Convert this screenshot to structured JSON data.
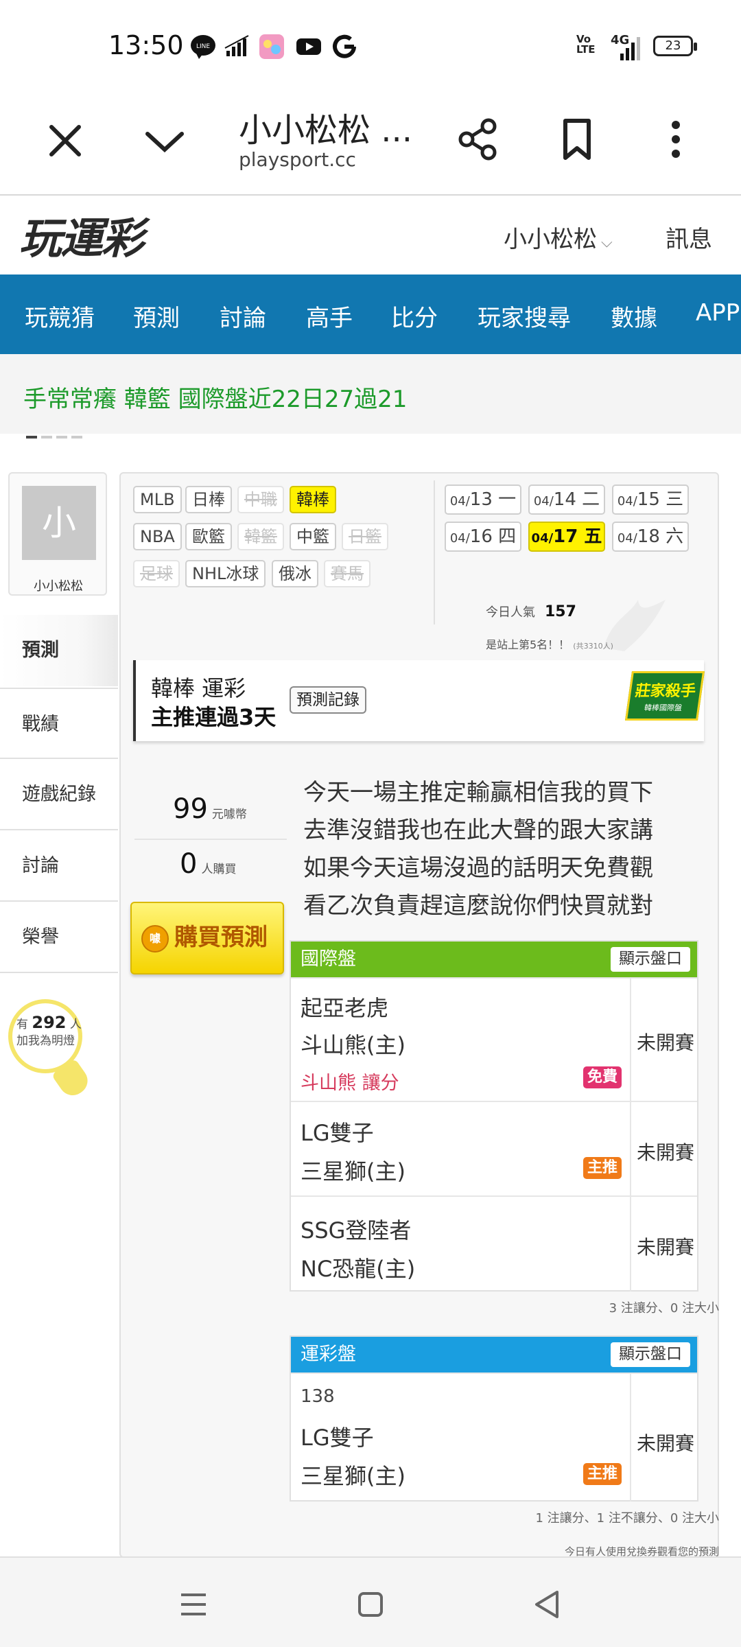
{
  "status": {
    "time": "13:50",
    "battery": "23",
    "network": "4G",
    "volte": "Vo LTE"
  },
  "browser": {
    "title": "小小松松 ...",
    "url": "playsport.cc"
  },
  "site": {
    "logo": "玩運彩",
    "user": "小小松松",
    "messages": "訊息"
  },
  "nav": [
    "玩競猜",
    "預測",
    "討論",
    "高手",
    "比分",
    "玩家搜尋",
    "數據",
    "APP"
  ],
  "marquee": "手常常癢 韓籃 國際盤近22日27過21",
  "profile": {
    "avatar_char": "小",
    "name": "小小松松"
  },
  "sidebar": [
    "預測",
    "戰績",
    "遊戲紀錄",
    "討論",
    "榮譽"
  ],
  "followers": {
    "prefix": "有",
    "count": "292",
    "unit": "人",
    "text": "加我為明燈"
  },
  "leagues": [
    {
      "label": "MLB",
      "state": "normal"
    },
    {
      "label": "日棒",
      "state": "normal"
    },
    {
      "label": "中職",
      "state": "off"
    },
    {
      "label": "韓棒",
      "state": "selected"
    },
    {
      "label": "NBA",
      "state": "normal"
    },
    {
      "label": "歐籃",
      "state": "normal"
    },
    {
      "label": "韓籃",
      "state": "off"
    },
    {
      "label": "中籃",
      "state": "normal"
    },
    {
      "label": "日籃",
      "state": "off"
    },
    {
      "label": "足球",
      "state": "off"
    },
    {
      "label": "NHL冰球",
      "state": "normal"
    },
    {
      "label": "俄冰",
      "state": "normal"
    },
    {
      "label": "賽馬",
      "state": "off"
    }
  ],
  "dates": [
    {
      "md": "04/",
      "d": "13",
      "w": "一"
    },
    {
      "md": "04/",
      "d": "14",
      "w": "二"
    },
    {
      "md": "04/",
      "d": "15",
      "w": "三"
    },
    {
      "md": "04/",
      "d": "16",
      "w": "四"
    },
    {
      "md": "04/",
      "d": "17",
      "w": "五",
      "selected": true
    },
    {
      "md": "04/",
      "d": "18",
      "w": "六"
    }
  ],
  "popularity": {
    "label": "今日人氣",
    "value": "157",
    "rank": "是站上第5名！！",
    "total": "(共3310人)"
  },
  "banner": {
    "line1": "韓棒 運彩",
    "line2": "主推連過3天",
    "record_btn": "預測記錄",
    "badge": "莊家殺手",
    "badge_sub": "韓棒國際盤"
  },
  "price": {
    "coins": "99",
    "coins_unit": "元噱幣",
    "buyers": "0",
    "buyers_unit": "人購買",
    "buy_btn": "購買預測",
    "coin_icon": "噱"
  },
  "comment": "今天一場主推定輸贏相信我的買下去準沒錯我也在此大聲的跟大家講如果今天這場沒過的話明天免費觀看乙次負責趕這麼說你們快買就對",
  "intl": {
    "title": "國際盤",
    "show_btn": "顯示盤口",
    "color": "#6cbb1c",
    "games": [
      {
        "away": "起亞老虎",
        "home": "斗山熊(主)",
        "pick": "斗山熊 讓分",
        "tag": "免費",
        "status": "未開賽"
      },
      {
        "away": "LG雙子",
        "home": "三星獅(主)",
        "tag": "主推",
        "status": "未開賽"
      },
      {
        "away": "SSG登陸者",
        "home": "NC恐龍(主)",
        "status": "未開賽"
      }
    ],
    "note": "3 注讓分、0 注大小"
  },
  "sports": {
    "title": "運彩盤",
    "show_btn": "顯示盤口",
    "color": "#1a9ee0",
    "games": [
      {
        "num": "138",
        "away": "LG雙子",
        "home": "三星獅(主)",
        "tag": "主推",
        "status": "未開賽"
      }
    ],
    "note": "1 注讓分、1 注不讓分、0 注大小"
  },
  "footer_note": "今日有人使用兌換券觀看您的預測"
}
